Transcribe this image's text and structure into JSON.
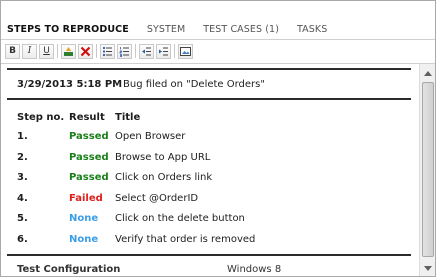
{
  "tabs": [
    {
      "label": "STEPS TO REPRODUCE",
      "active": true
    },
    {
      "label": "SYSTEM",
      "active": false
    },
    {
      "label": "TEST CASES (1)",
      "active": false
    },
    {
      "label": "TASKS",
      "active": false
    }
  ],
  "toolbar": {
    "bold": "B",
    "italic": "I",
    "underline": "U",
    "icons": [
      "bold-icon",
      "italic-icon",
      "underline-icon",
      "insert-link-icon",
      "clear-format-icon",
      "bullet-list-icon",
      "numbered-list-icon",
      "decrease-indent-icon",
      "increase-indent-icon",
      "insert-image-icon"
    ]
  },
  "entry": {
    "date": "3/29/2013 5:18 PM",
    "note": "Bug filed on \"Delete Orders\""
  },
  "steps_table": {
    "headers": {
      "step": "Step no.",
      "result": "Result",
      "title": "Title"
    },
    "rows": [
      {
        "step": "1.",
        "result": "Passed",
        "title": "Open Browser"
      },
      {
        "step": "2.",
        "result": "Passed",
        "title": "Browse to App URL"
      },
      {
        "step": "3.",
        "result": "Passed",
        "title": "Click on Orders link"
      },
      {
        "step": "4.",
        "result": "Failed",
        "title": "Select @OrderID"
      },
      {
        "step": "5.",
        "result": "None",
        "title": "Click on the delete button"
      },
      {
        "step": "6.",
        "result": "None",
        "title": "Verify that order is removed"
      }
    ]
  },
  "partial_footer": {
    "left": "Test Configuration",
    "right": "Windows 8"
  },
  "colors": {
    "passed": "#1a7f1a",
    "failed": "#e0201c",
    "none": "#3b9ee5"
  }
}
